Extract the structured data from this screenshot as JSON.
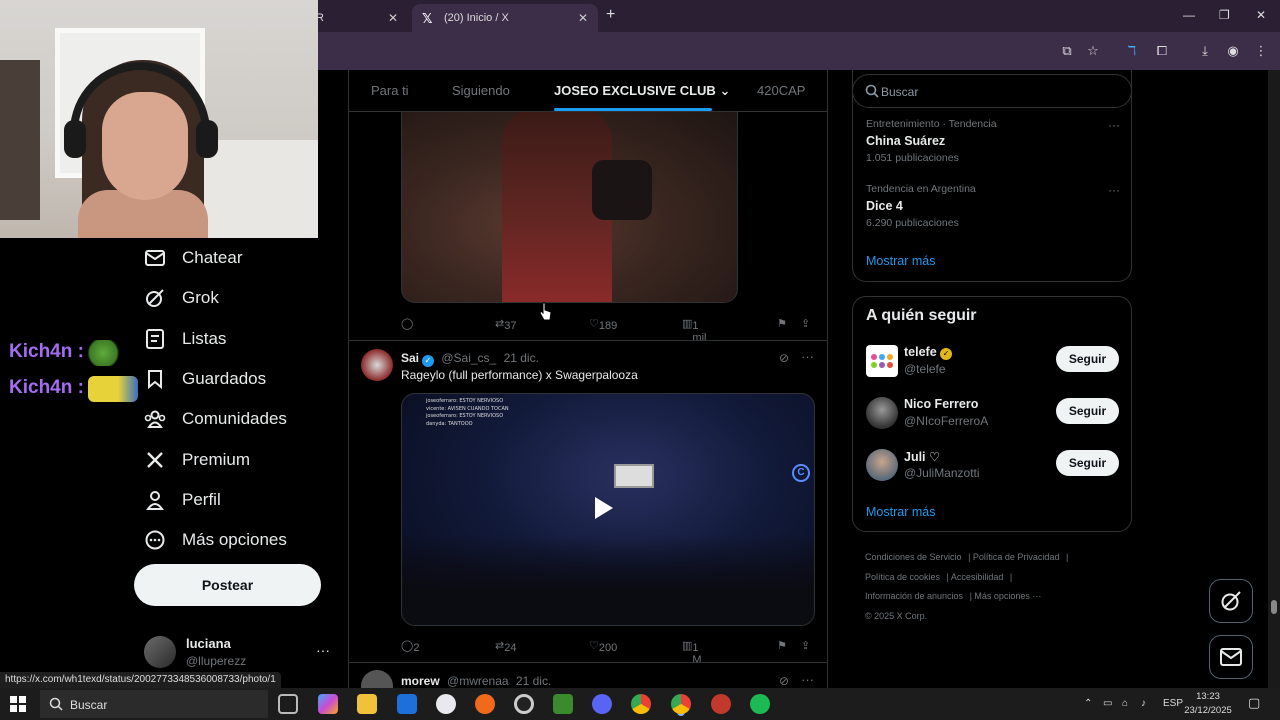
{
  "browser": {
    "tab_inactive_suffix": "R",
    "tab_active_title": "(20) Inicio / X",
    "tab_close": "✕",
    "new_tab": "+",
    "status_url": "https://x.com/wh1texd/status/2002773348536008733/photo/1"
  },
  "chat": [
    {
      "name": "Kich4n :",
      "emote": "pepe-emote"
    },
    {
      "name": "Kich4n :",
      "emote": "minion-emote"
    }
  ],
  "nav": {
    "items": [
      {
        "label": "Chatear",
        "icon": "mail-icon"
      },
      {
        "label": "Grok",
        "icon": "grok-icon"
      },
      {
        "label": "Listas",
        "icon": "list-icon"
      },
      {
        "label": "Guardados",
        "icon": "bookmark-icon"
      },
      {
        "label": "Comunidades",
        "icon": "communities-icon"
      },
      {
        "label": "Premium",
        "icon": "x-logo-icon"
      },
      {
        "label": "Perfil",
        "icon": "person-icon"
      },
      {
        "label": "Más opciones",
        "icon": "more-circle-icon"
      }
    ],
    "post_label": "Postear",
    "profile": {
      "name": "luciana",
      "handle": "@lluperezz",
      "more": "···"
    }
  },
  "timeline": {
    "tabs": [
      "Para ti",
      "Siguiendo",
      "JOSEO EXCLUSIVE CLUB",
      "420CAP"
    ],
    "tweet1_actions": {
      "replies": "",
      "reposts": "37",
      "likes": "189",
      "views": "1 mil"
    },
    "tweet2": {
      "name": "Sai",
      "handle": "@Sai_cs_",
      "date": "21 dic.",
      "text": "Rageylo (full performance) x Swagerpalooza",
      "overlay_lines": [
        "joseoferraro: ESTOY NERVIOSO",
        "vicente: AVISEN CUANDO TOCAN",
        "joseoferraro: ESTOY NERVIOSO",
        "danyda: TANTOOO"
      ],
      "actions": {
        "replies": "2",
        "reposts": "24",
        "likes": "200",
        "views": "1 M"
      }
    },
    "tweet3": {
      "name": "morew",
      "handle": "@mwrenaa",
      "date": "21 dic."
    }
  },
  "sidebar": {
    "search_placeholder": "Buscar",
    "trends": [
      {
        "context": "Entretenimiento · Tendencia",
        "title": "China Suárez",
        "count": "1.051 publicaciones"
      },
      {
        "context": "Tendencia en Argentina",
        "title": "Dice 4",
        "count": "6.290 publicaciones"
      }
    ],
    "show_more": "Mostrar más",
    "who_to_follow_title": "A quién seguir",
    "follow": [
      {
        "name": "telefe",
        "handle": "@telefe",
        "button": "Seguir"
      },
      {
        "name": "Nico Ferrero",
        "handle": "@NIcoFerreroA",
        "button": "Seguir"
      },
      {
        "name": "Juli ♡",
        "handle": "@JuliManzotti",
        "button": "Seguir"
      }
    ],
    "show_more_2": "Mostrar más",
    "footer": {
      "terms": "Condiciones de Servicio",
      "privacy": "Política de Privacidad",
      "cookies": "Política de cookies",
      "accessibility": "Accesibilidad",
      "ads": "Información de anuncios",
      "more": "Más opciones ···",
      "copyright": "© 2025 X Corp."
    }
  },
  "taskbar": {
    "search_label": "Buscar",
    "lang": "ESP",
    "time": "13:23",
    "date": "23/12/2025"
  },
  "colors": {
    "accent": "#1d9bf0",
    "chat_name": "#a46cf0",
    "titlebar": "#2a1f33",
    "addressbar": "#3c2d48"
  }
}
